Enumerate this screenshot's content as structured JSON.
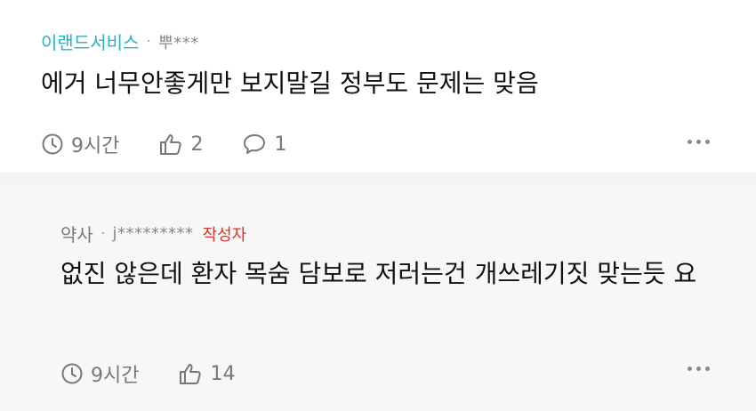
{
  "comments": [
    {
      "category": "이랜드서비스",
      "separator": "·",
      "username": "뿌***",
      "author_badge": "",
      "text": "에거 너무안좋게만 보지말길 정부도 문제는 맞음",
      "time": "9시간",
      "likes": "2",
      "replies": "1"
    },
    {
      "category": "약사",
      "separator": "·",
      "username": "j*********",
      "author_badge": "작성자",
      "text": "없진 않은데 환자 목숨 담보로 저러는건 개쓰레기짓 맞는듯 요",
      "time": "9시간",
      "likes": "14"
    }
  ],
  "colors": {
    "category_accent": "#2bb0c6",
    "author_badge": "#d7352b"
  },
  "icons": [
    "clock-icon",
    "thumbs-up-icon",
    "comment-icon",
    "more-options-icon"
  ]
}
